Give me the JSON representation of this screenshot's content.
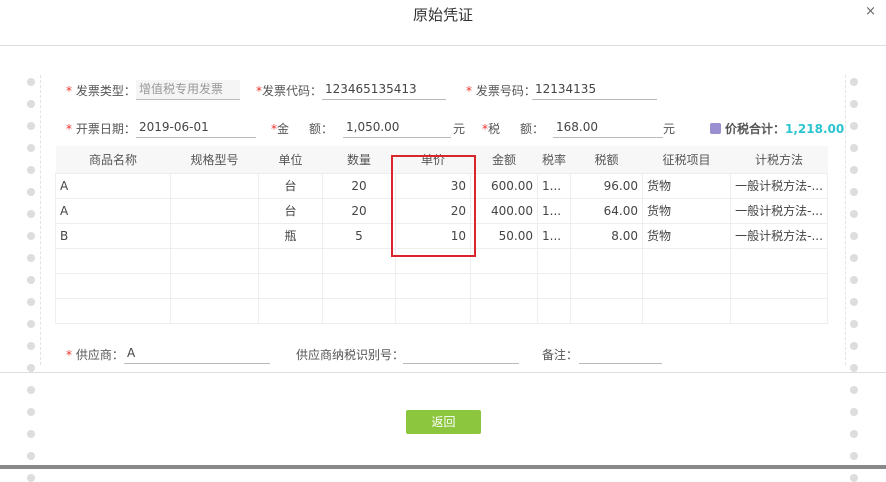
{
  "dialog": {
    "title": "原始凭证",
    "close_icon": "×"
  },
  "form": {
    "invoice_type": {
      "label": "发票类型：",
      "value": "增值税专用发票"
    },
    "invoice_code": {
      "label": "发票代码：",
      "value": "123465135413"
    },
    "invoice_number": {
      "label": "发票号码：",
      "value": "12134135"
    },
    "invoice_date": {
      "label": "开票日期：",
      "value": "2019-06-01"
    },
    "amount": {
      "label1": "金",
      "label2": "额：",
      "value": "1,050.00",
      "unit": "元"
    },
    "tax": {
      "label1": "税",
      "label2": "额：",
      "value": "168.00",
      "unit": "元"
    },
    "total": {
      "label": "价税合计：",
      "value": "1,218.00"
    },
    "required_mark": "*"
  },
  "table": {
    "headers": [
      "商品名称",
      "规格型号",
      "单位",
      "数量",
      "单价",
      "金额",
      "税率",
      "税额",
      "征税项目",
      "计税方法"
    ],
    "rows": [
      [
        "A",
        "",
        "台",
        "20",
        "30",
        "600.00",
        "1...",
        "96.00",
        "货物",
        "一般计税方法-..."
      ],
      [
        "A",
        "",
        "台",
        "20",
        "20",
        "400.00",
        "1...",
        "64.00",
        "货物",
        "一般计税方法-..."
      ],
      [
        "B",
        "",
        "瓶",
        "5",
        "10",
        "50.00",
        "1...",
        "8.00",
        "货物",
        "一般计税方法-..."
      ]
    ]
  },
  "footer_form": {
    "supplier": {
      "label": "供应商：",
      "value": "A"
    },
    "supplier_tax_id": {
      "label": "供应商纳税识别号：",
      "value": ""
    },
    "remark": {
      "label": "备注：",
      "value": ""
    }
  },
  "buttons": {
    "return": "返回"
  },
  "colors": {
    "highlight": "#d9262c",
    "accent": "#2bc4d0",
    "button": "#8cc63f"
  }
}
